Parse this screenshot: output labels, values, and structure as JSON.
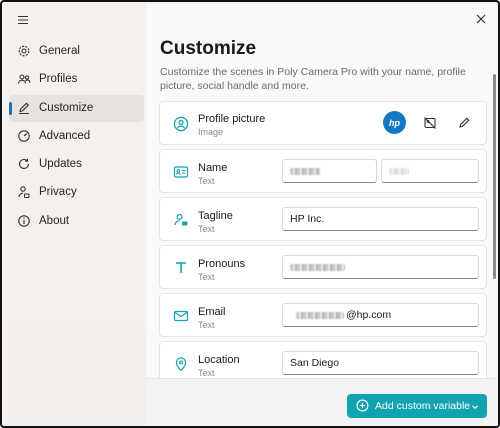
{
  "colors": {
    "accent": "#11a3b0",
    "indicator": "#1a73b8",
    "avatar": "#1479c4"
  },
  "window": {
    "menu_icon": "hamburger-icon",
    "close_icon": "close-icon"
  },
  "sidebar": {
    "items": [
      {
        "label": "General",
        "icon": "gear-icon",
        "active": false
      },
      {
        "label": "Profiles",
        "icon": "people-icon",
        "active": false
      },
      {
        "label": "Customize",
        "icon": "pen-icon",
        "active": true
      },
      {
        "label": "Advanced",
        "icon": "gauge-icon",
        "active": false
      },
      {
        "label": "Updates",
        "icon": "refresh-icon",
        "active": false
      },
      {
        "label": "Privacy",
        "icon": "person-lock-icon",
        "active": false
      },
      {
        "label": "About",
        "icon": "info-icon",
        "active": false
      }
    ]
  },
  "main": {
    "title": "Customize",
    "subtitle": "Customize the scenes in Poly Camera Pro with your name, profile picture, social handle and more.",
    "profile": {
      "title": "Profile picture",
      "type": "Image",
      "avatar_text": "hp"
    },
    "fields": [
      {
        "title": "Name",
        "type": "Text",
        "value": "",
        "value2": ""
      },
      {
        "title": "Tagline",
        "type": "Text",
        "value": "HP Inc."
      },
      {
        "title": "Pronouns",
        "type": "Text",
        "value": ""
      },
      {
        "title": "Email",
        "type": "Text",
        "value": "@hp.com"
      },
      {
        "title": "Location",
        "type": "Text",
        "value": "San Diego"
      }
    ],
    "add_button": "Add custom variable"
  }
}
